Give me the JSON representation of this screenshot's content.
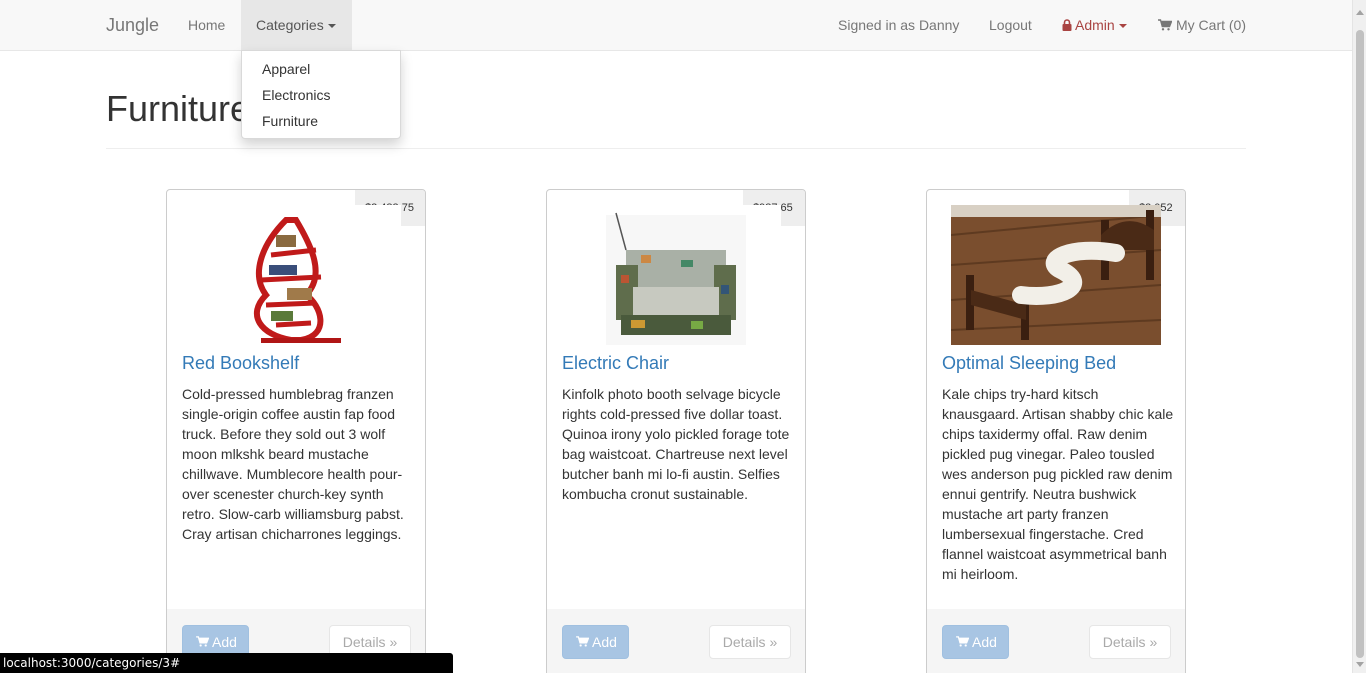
{
  "navbar": {
    "brand": "Jungle",
    "home": "Home",
    "categories": "Categories",
    "signed_in": "Signed in as Danny",
    "logout": "Logout",
    "admin": "Admin",
    "cart": "My Cart (0)"
  },
  "dropdown": {
    "items": [
      "Apparel",
      "Electronics",
      "Furniture"
    ]
  },
  "page": {
    "title": "Furniture"
  },
  "products": [
    {
      "price": "$2,483.75",
      "name": "Red Bookshelf",
      "description": "Cold-pressed humblebrag franzen single-origin coffee austin fap food truck. Before they sold out 3 wolf moon mlkshk beard mustache chillwave. Mumblecore health pour-over scenester church-key synth retro. Slow-carb williamsburg pabst. Cray artisan chicharrones leggings.",
      "add_label": "Add",
      "details_label": "Details »"
    },
    {
      "price": "$987.65",
      "name": "Electric Chair",
      "description": "Kinfolk photo booth selvage bicycle rights cold-pressed five dollar toast. Quinoa irony yolo pickled forage tote bag waistcoat. Chartreuse next level butcher banh mi lo-fi austin. Selfies kombucha cronut sustainable.",
      "add_label": "Add",
      "details_label": "Details »"
    },
    {
      "price": "$3,052",
      "name": "Optimal Sleeping Bed",
      "description": "Kale chips try-hard kitsch knausgaard. Artisan shabby chic kale chips taxidermy offal. Raw denim pickled pug vinegar. Paleo tousled wes anderson pug pickled raw denim ennui gentrify. Neutra bushwick mustache art party franzen lumbersexual fingerstache. Cred flannel waistcoat asymmetrical banh mi heirloom.",
      "add_label": "Add",
      "details_label": "Details »"
    }
  ],
  "statusbar": {
    "url": "localhost:3000/categories/3#"
  },
  "colors": {
    "link": "#337ab7",
    "admin": "#a94442",
    "navbar_bg": "#f8f8f8",
    "add_button": "#a8c5e3"
  }
}
